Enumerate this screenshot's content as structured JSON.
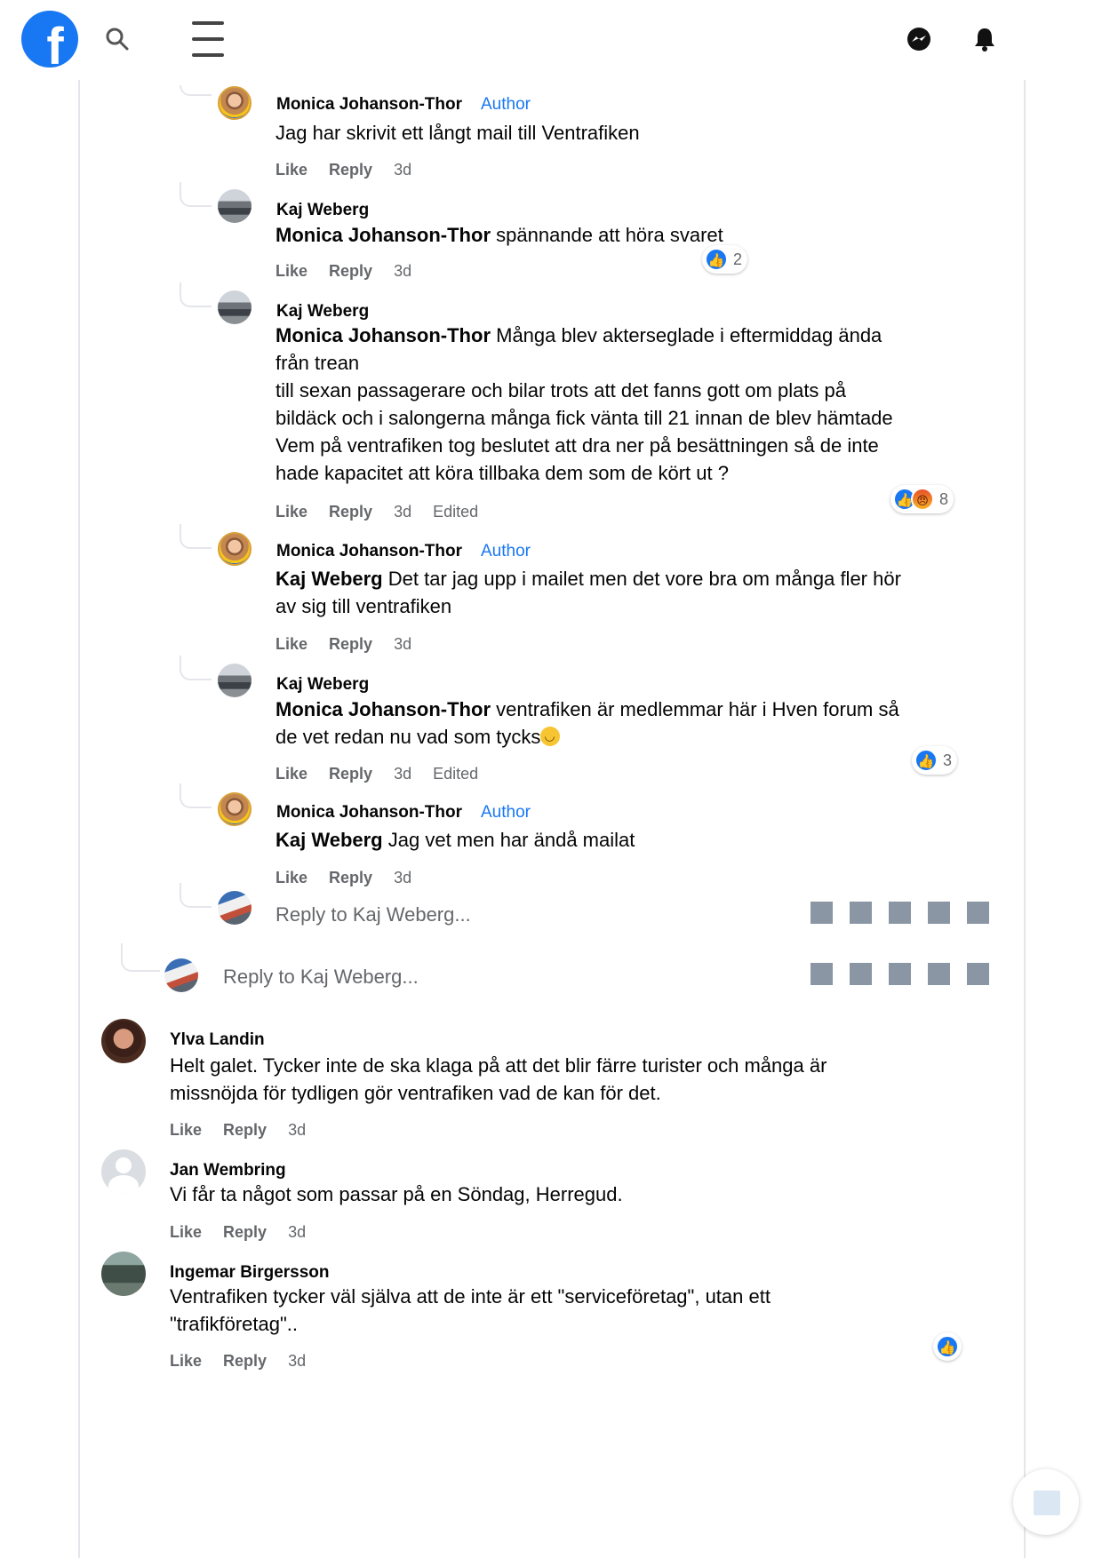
{
  "app": {
    "logo_letter": "f"
  },
  "labels": {
    "like": "Like",
    "reply": "Reply",
    "author": "Author",
    "edited": "Edited"
  },
  "nested_comments": [
    {
      "author": "Monica Johanson-Thor",
      "is_author": true,
      "mention": "",
      "text": "Jag har skrivit ett långt mail till Ventrafiken",
      "time": "3d",
      "edited": false,
      "reaction_count": ""
    },
    {
      "author": "Kaj Weberg",
      "is_author": false,
      "mention": "Monica Johanson-Thor",
      "text": "spännande att höra svaret",
      "time": "3d",
      "edited": false,
      "reaction_count": "2"
    },
    {
      "author": "Kaj Weberg",
      "is_author": false,
      "mention": "Monica Johanson-Thor",
      "text_lines": [
        "Många blev akterseglade i eftermiddag ända",
        "från trean",
        "till sexan passagerare och bilar trots att det fanns gott om plats på",
        "bildäck och i salongerna många fick vänta till 21 innan de blev hämtade",
        "Vem på ventrafiken tog beslutet att dra ner på besättningen så de inte",
        "hade kapacitet att köra tillbaka dem som de kört ut ?"
      ],
      "time": "3d",
      "edited": true,
      "reaction_count": "8"
    },
    {
      "author": "Monica Johanson-Thor",
      "is_author": true,
      "mention": "Kaj Weberg",
      "text_lines": [
        "Det tar jag upp i mailet men det vore bra om många fler hör",
        "av sig till ventrafiken"
      ],
      "time": "3d",
      "edited": false,
      "reaction_count": ""
    },
    {
      "author": "Kaj Weberg",
      "is_author": false,
      "mention": "Monica Johanson-Thor",
      "text_lines": [
        "ventrafiken är medlemmar här i Hven forum så",
        "de vet redan nu vad som tycks"
      ],
      "time": "3d",
      "edited": true,
      "reaction_count": "3"
    },
    {
      "author": "Monica Johanson-Thor",
      "is_author": true,
      "mention": "Kaj Weberg",
      "text": "Jag vet men har ändå mailat",
      "time": "3d",
      "edited": false,
      "reaction_count": ""
    }
  ],
  "reply_inputs": [
    {
      "placeholder": "Reply to Kaj Weberg..."
    },
    {
      "placeholder": "Reply to Kaj Weberg..."
    }
  ],
  "top_comments": [
    {
      "author": "Ylva Landin",
      "text_lines": [
        "Helt galet. Tycker inte de ska klaga på att det blir färre turister och många är",
        "missnöjda för tydligen gör ventrafiken vad de kan för det."
      ],
      "time": "3d"
    },
    {
      "author": "Jan Wembring",
      "text_lines": [
        "Vi får ta något som passar på en Söndag, Herregud."
      ],
      "time": "3d"
    },
    {
      "author": "Ingemar Birgersson",
      "text_lines": [
        "Ventrafiken tycker väl själva att de inte är ett \"serviceföretag\", utan ett",
        "\"trafikföretag\".."
      ],
      "time": "3d"
    }
  ]
}
